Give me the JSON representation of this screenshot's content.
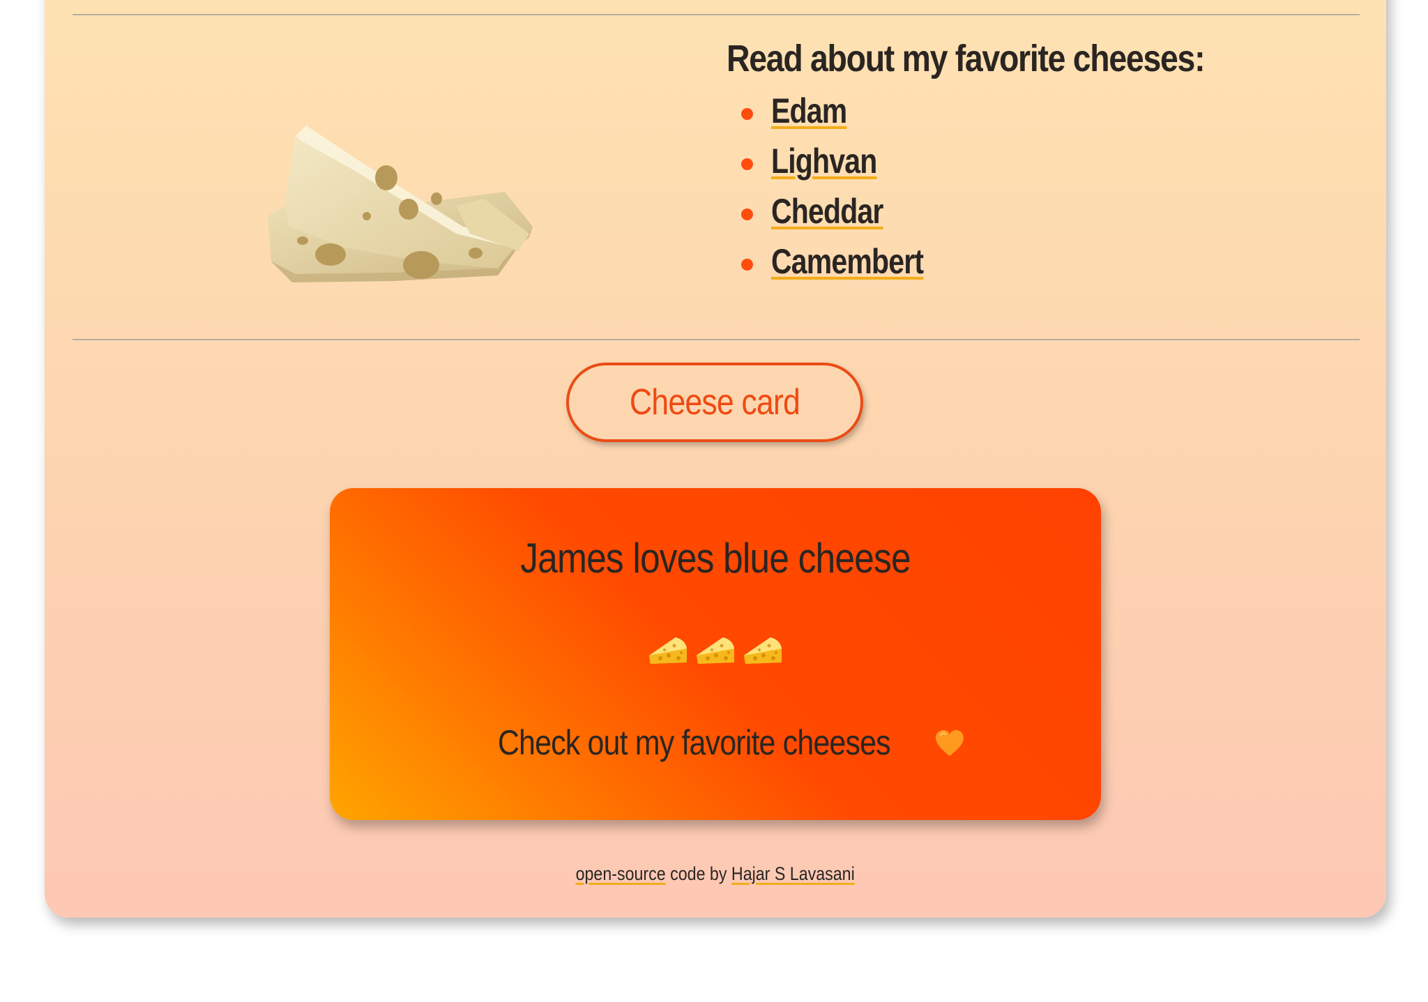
{
  "favorites": {
    "heading": "Read about my favorite cheeses:",
    "items": [
      {
        "label": "Edam"
      },
      {
        "label": "Lighvan"
      },
      {
        "label": "Cheddar"
      },
      {
        "label": "Camembert"
      }
    ]
  },
  "image": {
    "icon": "swiss-cheese-photo"
  },
  "card_button": {
    "label": "Cheese card"
  },
  "card": {
    "title": "James loves blue cheese",
    "emoji": [
      "cheese-wedge-icon",
      "cheese-wedge-icon",
      "cheese-wedge-icon"
    ],
    "footer": "Check out my favorite cheeses",
    "footer_icon": "orange-heart-icon"
  },
  "credit": {
    "link1": "open-source",
    "middle": "code by",
    "link2": "Hajar S Lavasani"
  },
  "colors": {
    "accent": "#ff4d0d",
    "underline": "#f3ad1a",
    "card_gradient_start": "#ffa500",
    "card_gradient_end": "#ff4200"
  }
}
